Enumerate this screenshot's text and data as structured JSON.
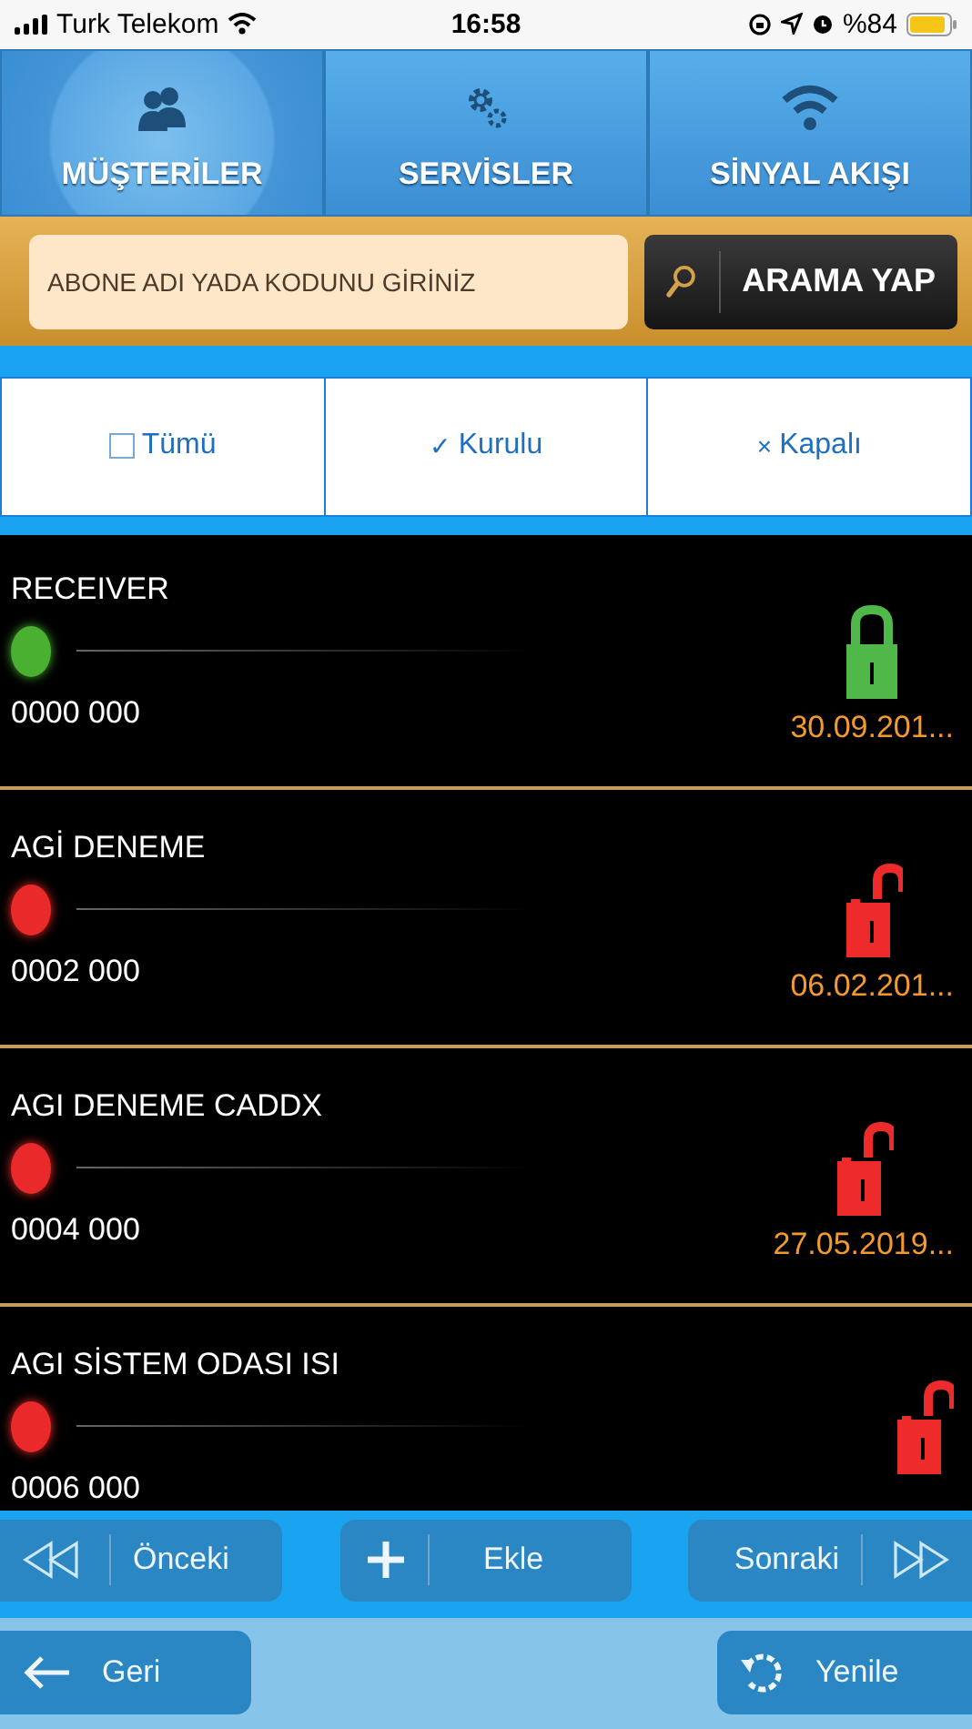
{
  "status_bar": {
    "carrier": "Turk Telekom",
    "time": "16:58",
    "battery": "%84"
  },
  "tabs": [
    {
      "label": "MÜŞTERİLER",
      "kind": "people",
      "selected": true
    },
    {
      "label": "SERVİSLER",
      "kind": "gears",
      "selected": false
    },
    {
      "label": "SİNYAL AKIŞI",
      "kind": "wifi",
      "selected": false
    }
  ],
  "search": {
    "placeholder": "ABONE ADI YADA KODUNU GİRİNİZ",
    "button": "ARAMA YAP"
  },
  "filters": [
    {
      "kind": "checkbox",
      "label": "Tümü"
    },
    {
      "kind": "glyph",
      "icon": "✓",
      "label": "Kurulu"
    },
    {
      "kind": "glyph",
      "icon": "×",
      "label": "Kapalı"
    }
  ],
  "subscribers": [
    {
      "name": "RECEIVER",
      "code": "0000 000",
      "online": true,
      "locked": true,
      "date": "30.09.201..."
    },
    {
      "name": "AGİ DENEME",
      "code": "0002 000",
      "online": false,
      "locked": false,
      "date": "06.02.201..."
    },
    {
      "name": "AGI DENEME CADDX",
      "code": "0004 000",
      "online": false,
      "locked": false,
      "date": "27.05.2019..."
    },
    {
      "name": "AGI SİSTEM ODASI ISI",
      "code": "0006 000",
      "online": false,
      "locked": false
    }
  ],
  "pager": {
    "previous": "Önceki",
    "add": "Ekle",
    "next": "Sonraki"
  },
  "footer": {
    "back": "Geri",
    "refresh": "Yenile"
  }
}
